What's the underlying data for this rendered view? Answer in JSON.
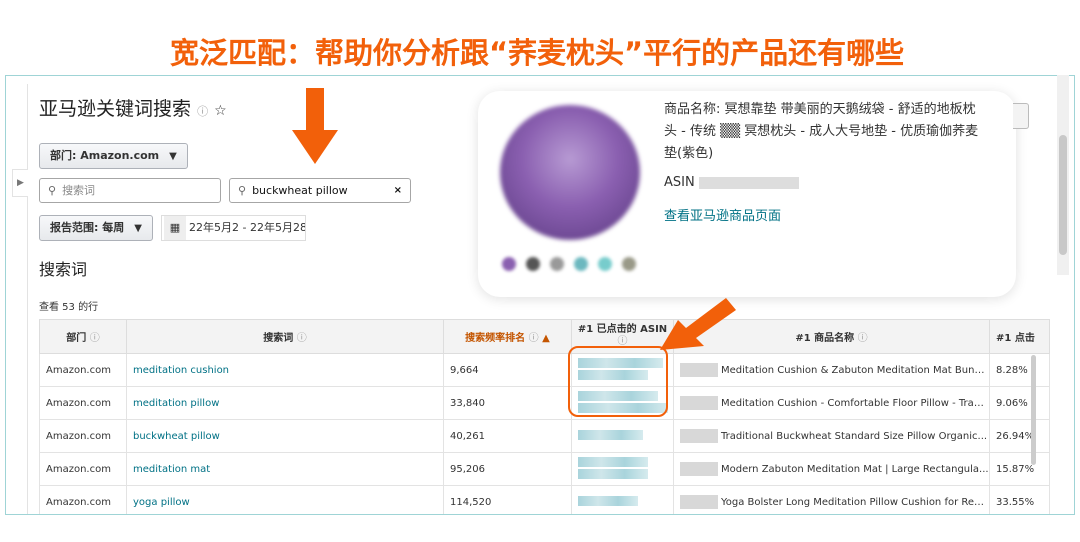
{
  "headline": "宽泛匹配：帮助你分析跟“荞麦枕头”平行的产品还有哪些",
  "page": {
    "title": "亚马逊关键词搜索",
    "department_label": "部门: Amazon.com",
    "search_placeholder": "搜索词",
    "search_value": "buckwheat pillow",
    "report_range_label": "报告范围: 每周",
    "date_start": "22年5月2",
    "date_sep": "-",
    "date_end": "22年5月28",
    "section_title": "搜索词",
    "row_count": "查看 53 的行"
  },
  "table": {
    "columns": [
      "部门",
      "搜索词",
      "搜索频率排名",
      "#1 已点击的 ASIN",
      "#1 商品名称",
      "#1 点击"
    ],
    "rows": [
      {
        "dept": "Amazon.com",
        "term": "meditation cushion",
        "rank": "9,664",
        "title": "Meditation Cushion & Zabuton Meditation Mat Bundle...",
        "share": "8.28%"
      },
      {
        "dept": "Amazon.com",
        "term": "meditation pillow",
        "rank": "33,840",
        "title": "Meditation Cushion - Comfortable Floor Pillow - Tradit...",
        "share": "9.06%"
      },
      {
        "dept": "Amazon.com",
        "term": "buckwheat pillow",
        "rank": "40,261",
        "title": "Traditional Buckwheat Standard Size Pillow Organic...",
        "share": "26.94%"
      },
      {
        "dept": "Amazon.com",
        "term": "meditation mat",
        "rank": "95,206",
        "title": "Modern Zabuton Meditation Mat | Large Rectangula...",
        "share": "15.87%"
      },
      {
        "dept": "Amazon.com",
        "term": "yoga pillow",
        "rank": "114,520",
        "title": "Yoga Bolster Long Meditation Pillow Cushion for Restor...",
        "share": "33.55%"
      }
    ]
  },
  "popup": {
    "product_name": "商品名称: 冥想靠垫 带美丽的天鹅绒袋 - 舒适的地板枕头 - 传统 ▒▒ 冥想枕头 - 成人大号地垫 - 优质瑜伽荞麦垫(紫色)",
    "asin_label": "ASIN",
    "link": "查看亚马逊商品页面"
  },
  "colors": {
    "accent": "#f2600a",
    "link": "#007185",
    "sorted": "#c45500"
  }
}
